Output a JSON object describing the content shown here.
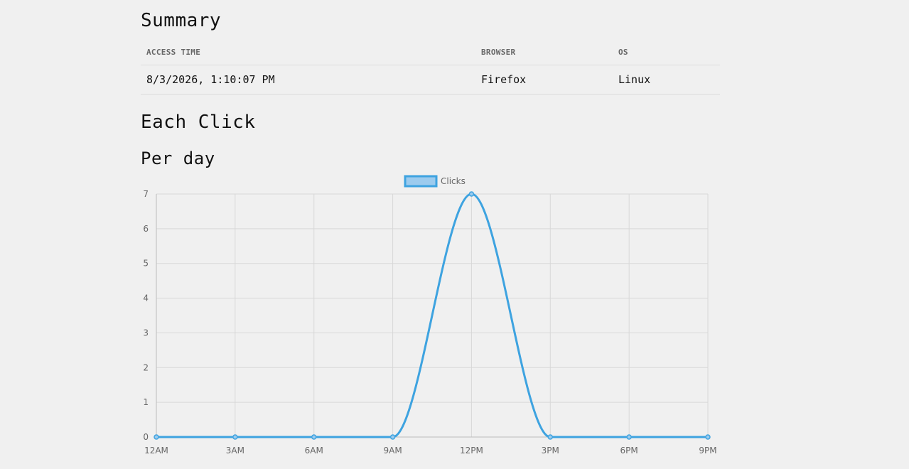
{
  "summary": {
    "title": "Summary",
    "columns": [
      "ACCESS TIME",
      "BROWSER",
      "OS"
    ],
    "rows": [
      [
        "8/3/2026, 1:10:07 PM",
        "Firefox",
        "Linux"
      ]
    ]
  },
  "each_click": {
    "title": "Each Click"
  },
  "per_day": {
    "title": "Per day"
  },
  "colors": {
    "line": "#3ea3e0",
    "fill": "#9ccbee",
    "grid": "#d8d8d8"
  },
  "chart_data": {
    "type": "line",
    "title": "",
    "xlabel": "",
    "ylabel": "",
    "categories": [
      "12AM",
      "3AM",
      "6AM",
      "9AM",
      "12PM",
      "3PM",
      "6PM",
      "9PM"
    ],
    "series": [
      {
        "name": "Clicks",
        "values": [
          0,
          0,
          0,
          0,
          7,
          0,
          0,
          0
        ]
      }
    ],
    "ylim": [
      0,
      7
    ],
    "yticks": [
      0,
      1,
      2,
      3,
      4,
      5,
      6,
      7
    ],
    "grid": true,
    "legend": "top-center"
  }
}
